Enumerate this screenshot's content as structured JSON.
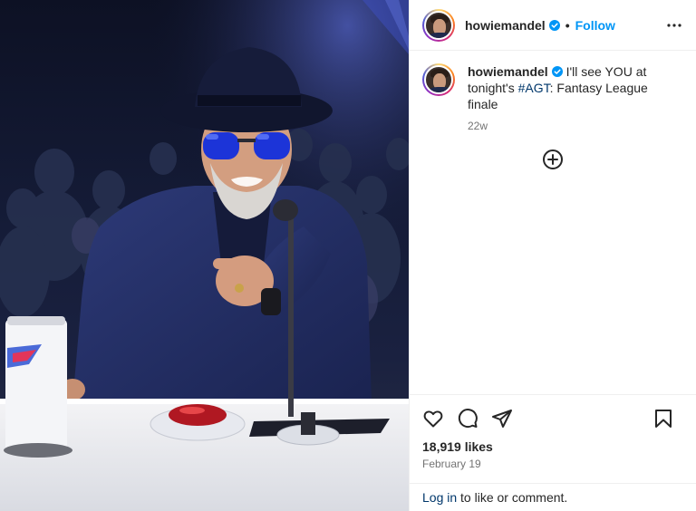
{
  "post": {
    "username": "howiemandel",
    "separator": "•",
    "follow_label": "Follow",
    "caption_before": "I'll see YOU at tonight's ",
    "hashtag": "#AGT",
    "caption_after": ": Fantasy League finale",
    "time_ago": "22w",
    "likes": "18,919 likes",
    "date": "February 19",
    "login_link": "Log in",
    "login_suffix": " to like or comment."
  },
  "icons": {
    "verified": "verified-badge-icon",
    "more": "more-options-icon",
    "load_more": "plus-circle-icon",
    "like": "heart-icon",
    "comment": "comment-icon",
    "share": "share-icon",
    "save": "bookmark-icon"
  },
  "colors": {
    "accent": "#0095f6",
    "link": "#00376b",
    "muted": "#737373",
    "text": "#262626",
    "border": "#efefef"
  }
}
